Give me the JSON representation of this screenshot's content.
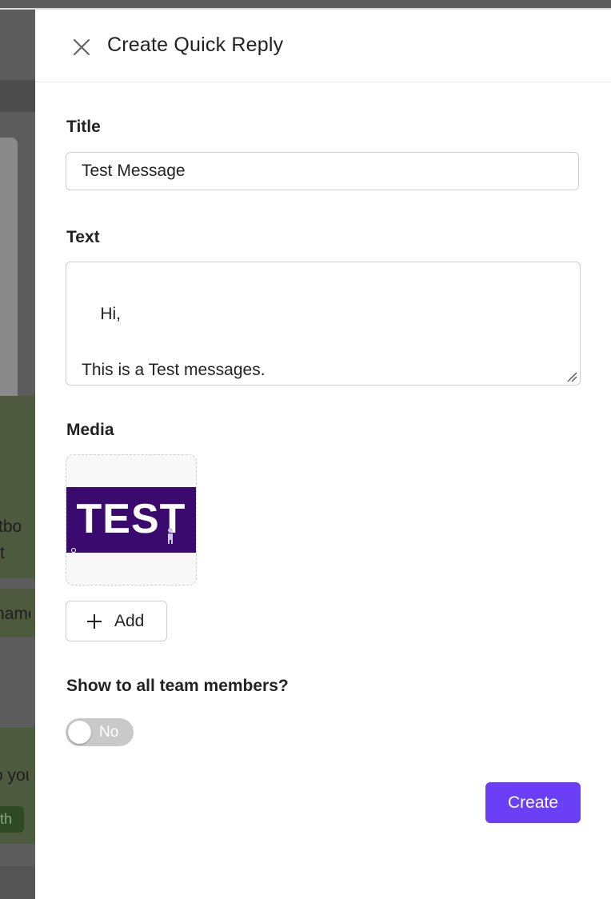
{
  "background": {
    "fragments": [
      "tbo",
      "t",
      "name",
      "o you",
      "th"
    ]
  },
  "drawer": {
    "title": "Create Quick Reply",
    "close_icon": "close-icon"
  },
  "form": {
    "title_label": "Title",
    "title_value": "Test Message",
    "text_label": "Text",
    "text_value": "Hi,\n\nThis is a Test messages.",
    "media_label": "Media",
    "media_items": [
      {
        "image_text": "TEST"
      }
    ],
    "add_label": "Add",
    "show_label": "Show to all team members?",
    "toggle_state": "No",
    "create_label": "Create"
  },
  "colors": {
    "accent": "#6a3ff5",
    "toggle_off": "#c9c9c9",
    "media_bg": "#3b0a6e"
  }
}
